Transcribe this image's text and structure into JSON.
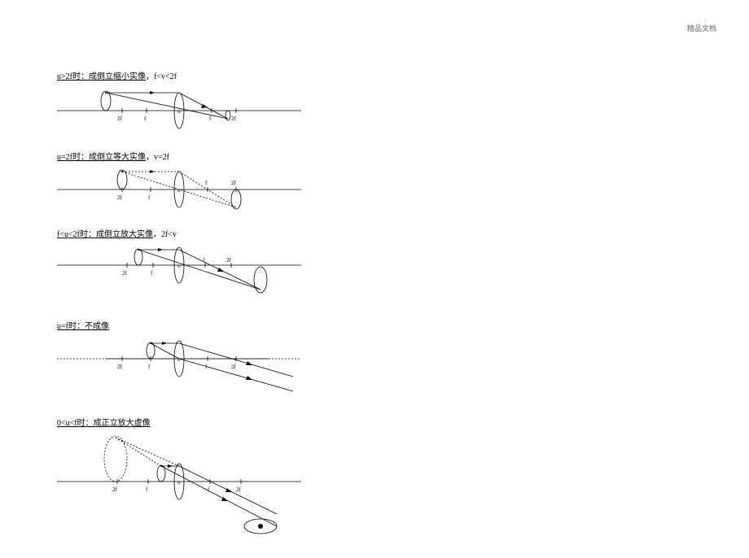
{
  "watermark": "精品文档",
  "cases": [
    {
      "title_u": "u>2f时：成倒立缩小实像",
      "title_tail": "，f<v<2f"
    },
    {
      "title_u": "u=2f时：成倒立等大实像",
      "title_tail": "，v=2f"
    },
    {
      "title_u": "f<u<2f时：成倒立放大实像",
      "title_tail": "，2f<v"
    },
    {
      "title_u": "u=f时：不成像",
      "title_tail": ""
    },
    {
      "title_u": "0<u<f时：成正立放大虚像",
      "title_tail": ""
    }
  ],
  "labels": {
    "f": "f",
    "twof": "2f",
    "o": "o"
  }
}
